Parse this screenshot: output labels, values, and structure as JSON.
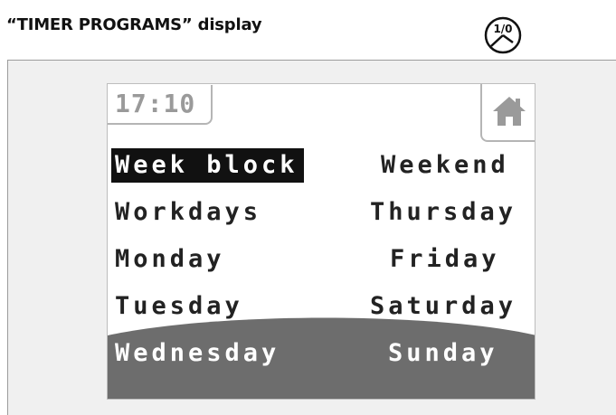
{
  "header": {
    "title": "“TIMER PROGRAMS” display",
    "timer_icon_text": "1/0"
  },
  "screen": {
    "time": "17:10",
    "home_icon": "home-icon",
    "left_column": [
      {
        "label": "Week block",
        "selected": true
      },
      {
        "label": "Workdays",
        "selected": false
      },
      {
        "label": "Monday",
        "selected": false
      },
      {
        "label": "Tuesday",
        "selected": false
      },
      {
        "label": "Wednesday",
        "selected": false
      }
    ],
    "right_column": [
      {
        "label": "Weekend",
        "selected": false
      },
      {
        "label": "Thursday",
        "selected": false
      },
      {
        "label": "Friday",
        "selected": false
      },
      {
        "label": "Saturday",
        "selected": false
      },
      {
        "label": "Sunday",
        "selected": false
      }
    ],
    "colors": {
      "selection": "#111111",
      "scroll_band": "#6d6d6d",
      "text": "#222222"
    }
  }
}
